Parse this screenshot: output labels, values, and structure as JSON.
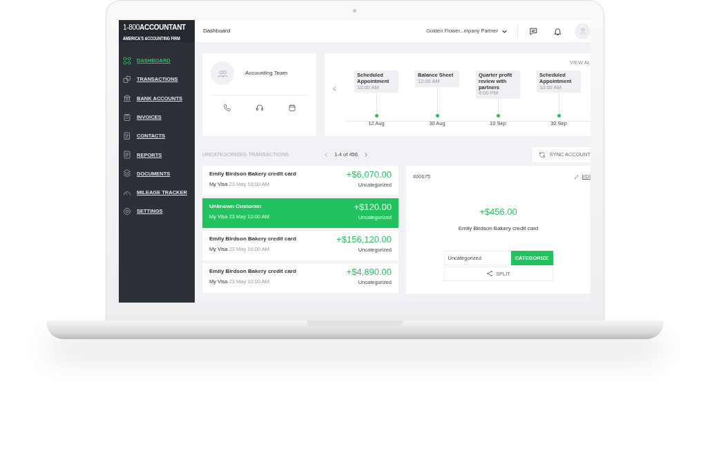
{
  "brand": {
    "prefix": "1-800",
    "name": "ACCOUNTANT",
    "tagline": "AMERICA'S ACCOUNTING FIRM"
  },
  "sidebar": {
    "items": [
      {
        "label": "DASHBOARD",
        "kind": "grid",
        "selected": true
      },
      {
        "label": "TRANSACTIONS",
        "kind": "transfer",
        "selected": false
      },
      {
        "label": "BANK ACCOUNTS",
        "kind": "bank",
        "selected": false
      },
      {
        "label": "INVOICES",
        "kind": "invoice",
        "selected": false
      },
      {
        "label": "CONTACTS",
        "kind": "contacts",
        "selected": false
      },
      {
        "label": "REPORTS",
        "kind": "report",
        "selected": false
      },
      {
        "label": "DOCUMENTS",
        "kind": "layers",
        "selected": false
      },
      {
        "label": "MILEAGE TRACKER",
        "kind": "gauge",
        "selected": false
      },
      {
        "label": "SETTINGS",
        "kind": "gear",
        "selected": false
      }
    ]
  },
  "header": {
    "title": "Dashboard",
    "account": "Golden Flower...mpany Partner"
  },
  "team_card": {
    "title": "Accounting Team"
  },
  "timeline": {
    "link": "VIEW AL",
    "events": [
      {
        "title": "Scheduled Appointment",
        "time": "10:00 AM",
        "date": "12 Aug"
      },
      {
        "title": "Balance Sheet",
        "time": "12:00 AM",
        "date": "30 Aug"
      },
      {
        "title": "Quarter profit review with partners",
        "time": "4:00 PM",
        "date": "10 Sep"
      },
      {
        "title": "Scheduled Appointment",
        "time": "10:00 AM",
        "date": "30 Sep"
      }
    ]
  },
  "transactions": {
    "title": "UNCATEGORIZED TRANSACTIONS",
    "pager": "1-4 of 456",
    "sync_button": "SYNC ACCOUNT",
    "items": [
      {
        "name": "Emily Birdson Bakery credit card",
        "account": "My Visa",
        "date": "23 May 10:00 AM",
        "amount": "+$6,070.00",
        "status": "Uncategorized",
        "selected": false
      },
      {
        "name": "Unknown Customer",
        "account": "My Visa",
        "date": "23 May 10:00 AM",
        "amount": "+$120.00",
        "status": "Uncategorized",
        "selected": true
      },
      {
        "name": "Emily Birdson Bakery credit card",
        "account": "My Visa",
        "date": "23 May 10:00 AM",
        "amount": "+$156,120.00",
        "status": "Uncategorized",
        "selected": false
      },
      {
        "name": "Emily Birdson Bakery credit card",
        "account": "My Visa",
        "date": "23 May 10:00 AM",
        "amount": "+$4,890.00",
        "status": "Uncategorized",
        "selected": false
      }
    ]
  },
  "detail": {
    "id": "#00675",
    "edit": "EDI",
    "amount": "+$456.00",
    "name": "Emily Birdson Bakery credit card",
    "category": "Uncategorized",
    "categorize_button": "CATEGORIZE",
    "split_button": "SPLIT"
  }
}
